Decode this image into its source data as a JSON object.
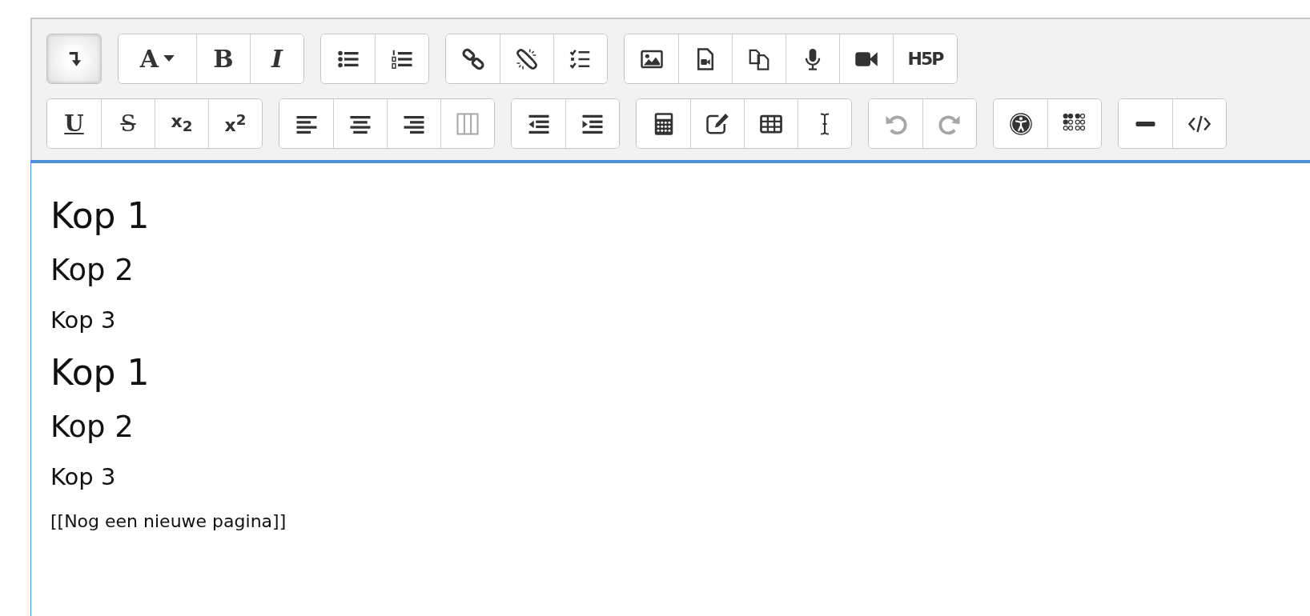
{
  "toolbar": {
    "rows": [
      {
        "groups": [
          {
            "buttons": [
              {
                "kind": "toggle",
                "pressed": true,
                "disabled": false
              }
            ]
          },
          {
            "buttons": [
              {
                "kind": "fontcolor",
                "glyph": "A",
                "pressed": false,
                "disabled": false
              },
              {
                "kind": "bold",
                "glyph": "B",
                "pressed": false,
                "disabled": false
              },
              {
                "kind": "italic",
                "glyph": "I",
                "pressed": false,
                "disabled": false
              }
            ]
          },
          {
            "buttons": [
              {
                "kind": "bullets",
                "pressed": false,
                "disabled": false
              },
              {
                "kind": "numbered",
                "pressed": false,
                "disabled": false
              }
            ]
          },
          {
            "buttons": [
              {
                "kind": "link",
                "pressed": false,
                "disabled": false
              },
              {
                "kind": "unlink",
                "pressed": false,
                "disabled": false
              },
              {
                "kind": "checklist",
                "pressed": false,
                "disabled": false
              }
            ]
          },
          {
            "buttons": [
              {
                "kind": "image",
                "pressed": false,
                "disabled": false
              },
              {
                "kind": "media",
                "pressed": false,
                "disabled": false
              },
              {
                "kind": "files",
                "pressed": false,
                "disabled": false
              },
              {
                "kind": "mic",
                "pressed": false,
                "disabled": false
              },
              {
                "kind": "video",
                "pressed": false,
                "disabled": false
              },
              {
                "kind": "h5p",
                "glyph": "H5P",
                "pressed": false,
                "disabled": false
              }
            ]
          }
        ]
      },
      {
        "groups": [
          {
            "buttons": [
              {
                "kind": "underline",
                "glyph": "U",
                "pressed": false,
                "disabled": false
              },
              {
                "kind": "strike",
                "glyph": "S",
                "pressed": false,
                "disabled": false
              },
              {
                "kind": "sub",
                "glyph": "x$_{2}$",
                "pressed": false,
                "disabled": false
              },
              {
                "kind": "sup",
                "glyph": "x$^{2}$",
                "pressed": false,
                "disabled": false
              }
            ]
          },
          {
            "buttons": [
              {
                "kind": "alignleft",
                "pressed": false,
                "disabled": false
              },
              {
                "kind": "aligncenter",
                "pressed": false,
                "disabled": false
              },
              {
                "kind": "alignright",
                "pressed": false,
                "disabled": false
              },
              {
                "kind": "columns",
                "pressed": false,
                "disabled": true
              }
            ]
          },
          {
            "buttons": [
              {
                "kind": "outdent",
                "pressed": false,
                "disabled": false
              },
              {
                "kind": "indent",
                "pressed": false,
                "disabled": false
              }
            ]
          },
          {
            "buttons": [
              {
                "kind": "calculator",
                "pressed": false,
                "disabled": false
              },
              {
                "kind": "edit",
                "pressed": false,
                "disabled": false
              },
              {
                "kind": "table",
                "pressed": false,
                "disabled": false
              },
              {
                "kind": "cursor",
                "pressed": false,
                "disabled": false
              }
            ]
          },
          {
            "buttons": [
              {
                "kind": "undo",
                "pressed": false,
                "disabled": true
              },
              {
                "kind": "redo",
                "pressed": false,
                "disabled": true
              }
            ]
          },
          {
            "buttons": [
              {
                "kind": "accessibility",
                "pressed": false,
                "disabled": false
              },
              {
                "kind": "braille",
                "pressed": false,
                "disabled": false
              }
            ]
          },
          {
            "buttons": [
              {
                "kind": "hr",
                "pressed": false,
                "disabled": false
              },
              {
                "kind": "code",
                "pressed": false,
                "disabled": false
              }
            ]
          }
        ]
      }
    ]
  },
  "editor": {
    "blocks": [
      {
        "kind": "h1",
        "text": "Kop 1"
      },
      {
        "kind": "h2",
        "text": "Kop 2"
      },
      {
        "kind": "h3",
        "text": "Kop 3"
      },
      {
        "kind": "h1",
        "text": "Kop 1"
      },
      {
        "kind": "h2",
        "text": "Kop 2"
      },
      {
        "kind": "h3",
        "text": "Kop 3"
      },
      {
        "kind": "p",
        "text": "[[Nog een nieuwe pagina]]"
      }
    ]
  }
}
